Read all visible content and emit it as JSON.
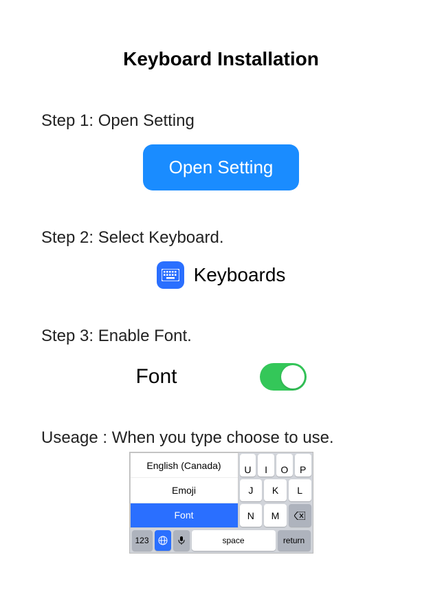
{
  "title": "Keyboard Installation",
  "step1": {
    "label": "Step 1: Open Setting",
    "button": "Open Setting"
  },
  "step2": {
    "label": "Step 2: Select Keyboard.",
    "item": "Keyboards"
  },
  "step3": {
    "label": "Step 3: Enable Font.",
    "item": "Font",
    "enabled": true
  },
  "usage": {
    "label": "Useage : When you type choose to use.",
    "menu": [
      "English (Canada)",
      "Emoji",
      "Font"
    ],
    "selected": "Font",
    "top_keys": [
      "U",
      "I",
      "O",
      "P"
    ],
    "mid_keys": [
      "J",
      "K",
      "L"
    ],
    "bot_keys": [
      "N",
      "M"
    ],
    "k123": "123",
    "space": "space",
    "return": "return"
  }
}
